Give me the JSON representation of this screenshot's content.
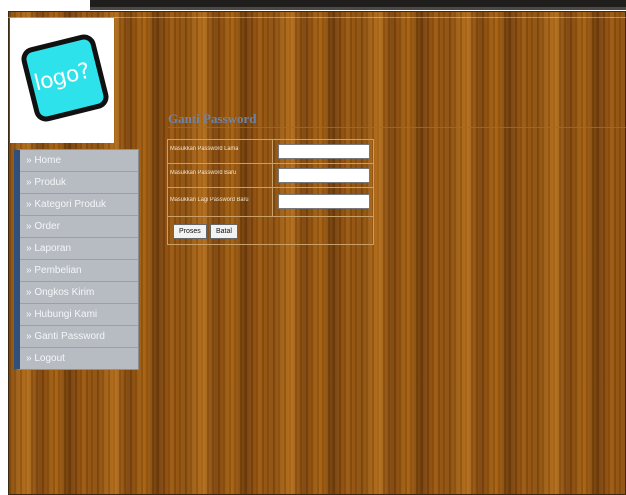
{
  "logo": {
    "text": "logo?"
  },
  "page": {
    "title": "Ganti Password"
  },
  "menu": {
    "items": [
      {
        "label": "» Home"
      },
      {
        "label": "» Produk"
      },
      {
        "label": "» Kategori Produk"
      },
      {
        "label": "» Order"
      },
      {
        "label": "» Laporan"
      },
      {
        "label": "» Pembelian"
      },
      {
        "label": "» Ongkos Kirim"
      },
      {
        "label": "» Hubungi Kami"
      },
      {
        "label": "» Ganti Password"
      },
      {
        "label": "» Logout"
      }
    ]
  },
  "form": {
    "old_password_label": "Masukkan Password Lama",
    "new_password_label": "Masukkan Password Baru",
    "confirm_password_label": "Masukkan Lagi Password Baru",
    "old_password_value": "",
    "new_password_value": "",
    "confirm_password_value": "",
    "submit_label": "Proses",
    "cancel_label": "Batal"
  }
}
